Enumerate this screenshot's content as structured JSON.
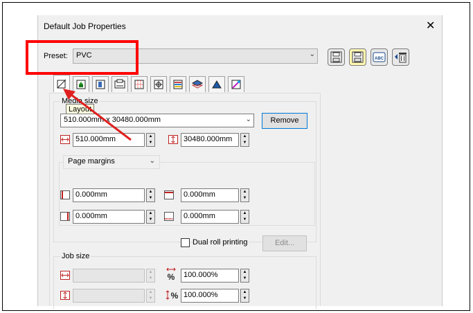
{
  "window": {
    "title": "Default Job Properties",
    "close_glyph": "✕"
  },
  "preset": {
    "label": "Preset:",
    "value": "PVC"
  },
  "toolbar_icons": [
    "save-preset-icon",
    "save-as-preset-icon",
    "rename-preset-icon",
    "delete-preset-icon"
  ],
  "toolbar_labels": {
    "rename": "ABC"
  },
  "tabs": [
    "layout-tab-icon",
    "color-tab-icon",
    "image-tab-icon",
    "printer-tab-icon",
    "grid-tab-icon",
    "marks-tab-icon",
    "color-bars-tab-icon",
    "layers-tab-icon",
    "shape-tab-icon",
    "effects-tab-icon"
  ],
  "tooltip": {
    "text": "Layout"
  },
  "media_size": {
    "heading": "Media size",
    "selected": "510.000mm x 30480.000mm",
    "remove_label": "Remove",
    "width": "510.000mm",
    "height": "30480.000mm"
  },
  "margins": {
    "mode": "Page margins",
    "left": "0.000mm",
    "top": "0.000mm",
    "right": "0.000mm",
    "bottom": "0.000mm"
  },
  "dual_roll": {
    "label": "Dual roll printing",
    "checked": false,
    "edit_label": "Edit..."
  },
  "job_size": {
    "heading": "Job size",
    "width": "",
    "height": "",
    "scale_x": "100.000%",
    "scale_y": "100.000%",
    "percent_glyph": "%"
  },
  "colors": {
    "accent": "#0078d7",
    "highlight": "#ff0000"
  }
}
